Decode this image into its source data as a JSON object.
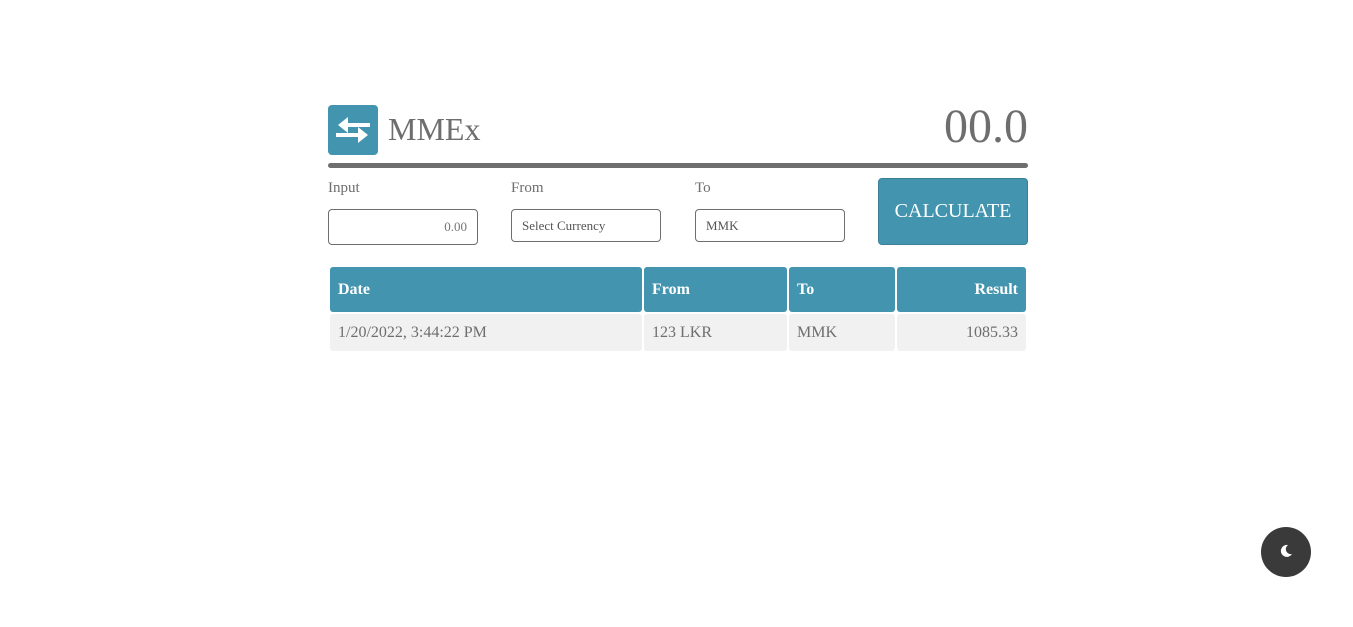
{
  "app": {
    "title": "MMEx",
    "result_display": "00.0"
  },
  "form": {
    "input_label": "Input",
    "input_value": "0.00",
    "from_label": "From",
    "from_value": "Select Currency",
    "to_label": "To",
    "to_value": "MMK",
    "calculate_label": "CALCULATE"
  },
  "history": {
    "columns": [
      "Date",
      "From",
      "To",
      "Result"
    ],
    "rows": [
      [
        "1/20/2022, 3:44:22 PM",
        "123 LKR",
        "MMK",
        "1085.33"
      ]
    ]
  },
  "icons": {
    "logo": "exchange-arrows-icon",
    "theme_toggle": "moon-icon"
  },
  "colors": {
    "accent": "#4294af",
    "text": "#6e6e6e",
    "row_bg": "#f1f1f1",
    "toggle_bg": "#3a3a3a"
  }
}
